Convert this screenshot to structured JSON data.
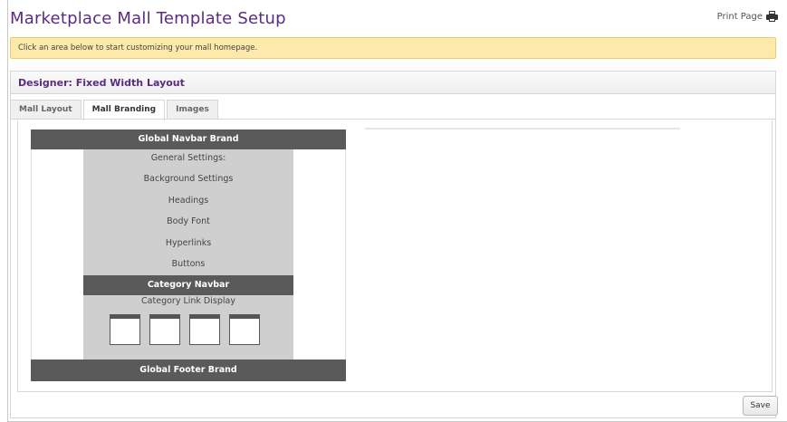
{
  "page": {
    "title": "Marketplace Mall Template Setup",
    "print_label": "Print Page",
    "print_icon": "printer-icon"
  },
  "notice": {
    "text": "Click an area below to start customizing your mall homepage."
  },
  "designer": {
    "title": "Designer: Fixed Width Layout"
  },
  "tabs": [
    {
      "label": "Mall Layout",
      "active": false
    },
    {
      "label": "Mall Branding",
      "active": true
    },
    {
      "label": "Images",
      "active": false
    }
  ],
  "layout": {
    "global_navbar": "Global Navbar Brand",
    "settings": [
      "General Settings:",
      "Background Settings",
      "Headings",
      "Body Font",
      "Hyperlinks",
      "Buttons"
    ],
    "category_navbar": "Category Navbar",
    "category_link_display": "Category Link Display",
    "global_footer": "Global Footer Brand"
  },
  "actions": {
    "save_label": "Save"
  },
  "colors": {
    "title": "#5b2b83",
    "notice_bg": "#fde9a9",
    "bar_dark": "#5a5a5a",
    "column_gray": "#cfcfcf"
  }
}
